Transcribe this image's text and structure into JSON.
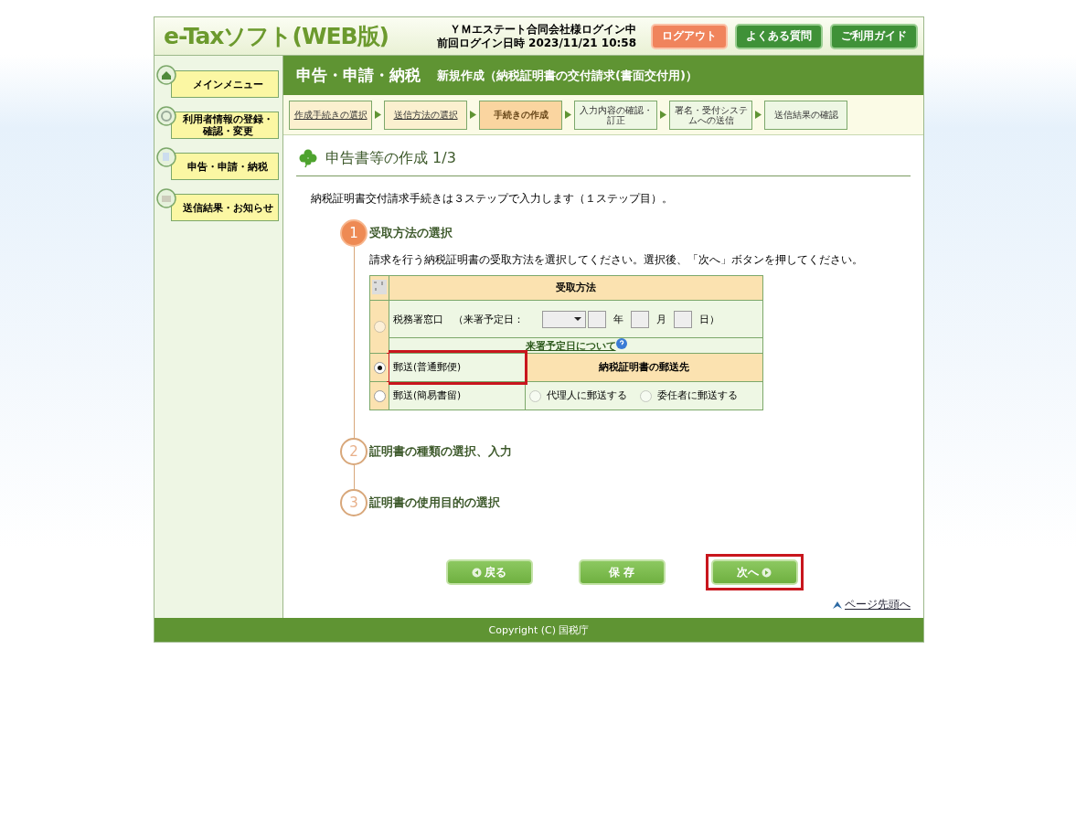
{
  "header": {
    "logo": "e-Taxソフト(WEB版)",
    "login_user": "ＹＭエステート合同会社様ログイン中",
    "last_login_label": "前回ログイン日時",
    "last_login": "2023/11/21 10:58",
    "buttons": [
      {
        "label": "ログアウト",
        "kind": "logout"
      },
      {
        "label": "よくある質問",
        "kind": "help"
      },
      {
        "label": "ご利用ガイド",
        "kind": "help"
      }
    ]
  },
  "sidebar": {
    "items": [
      {
        "label": "メインメニュー"
      },
      {
        "label": "利用者情報の登録・確認・変更"
      },
      {
        "label": "申告・申請・納税"
      },
      {
        "label": "送信結果・お知らせ"
      }
    ]
  },
  "page_header": {
    "title": "申告・申請・納税",
    "subtitle": "新規作成（納税証明書の交付請求(書面交付用)）"
  },
  "steps": [
    {
      "label": "作成手続きの選択",
      "completed": true,
      "selected": false
    },
    {
      "label": "送信方法の選択",
      "completed": true,
      "selected": false
    },
    {
      "label": "手続きの作成",
      "completed": false,
      "selected": true
    },
    {
      "label": "入力内容の確認・訂正",
      "completed": false,
      "selected": false
    },
    {
      "label": "署名・受付システムへの送信",
      "completed": false,
      "selected": false
    },
    {
      "label": "送信結果の確認",
      "completed": false,
      "selected": false
    }
  ],
  "section_title": "申告書等の作成 1/3",
  "intro": "納税証明書交付請求手続きは３ステップで入力します（１ステップ目）。",
  "wizard": [
    {
      "number": "1",
      "title": "受取方法の選択",
      "active": true
    },
    {
      "number": "2",
      "title": "証明書の種類の選択、入力",
      "active": false
    },
    {
      "number": "3",
      "title": "証明書の使用目的の選択",
      "active": false
    }
  ],
  "instruction": "請求を行う納税証明書の受取方法を選択してください。選択後、「次へ」ボタンを押してください。",
  "table": {
    "header": "受取方法",
    "counter": {
      "label": "税務署窓口",
      "date_label": "（来署予定日：",
      "year": "年",
      "month": "月",
      "day": "日）",
      "link": "来署予定日について",
      "selected": false
    },
    "options": [
      {
        "label": "郵送(普通郵便)",
        "selected": true,
        "highlighted": true
      },
      {
        "label": "郵送(簡易書留)",
        "selected": false,
        "highlighted": false
      }
    ],
    "destination_header": "納税証明書の郵送先",
    "destinations": [
      {
        "label": "代理人に郵送する",
        "selected": false
      },
      {
        "label": "委任者に郵送する",
        "selected": false
      }
    ]
  },
  "actions": [
    {
      "label": "戻る",
      "kind": "back",
      "highlighted": false
    },
    {
      "label": "保 存",
      "kind": "plain",
      "highlighted": false
    },
    {
      "label": "次へ",
      "kind": "next",
      "highlighted": true
    }
  ],
  "page_top_link": "ページ先頭へ",
  "footer": "Copyright (C) 国税庁"
}
